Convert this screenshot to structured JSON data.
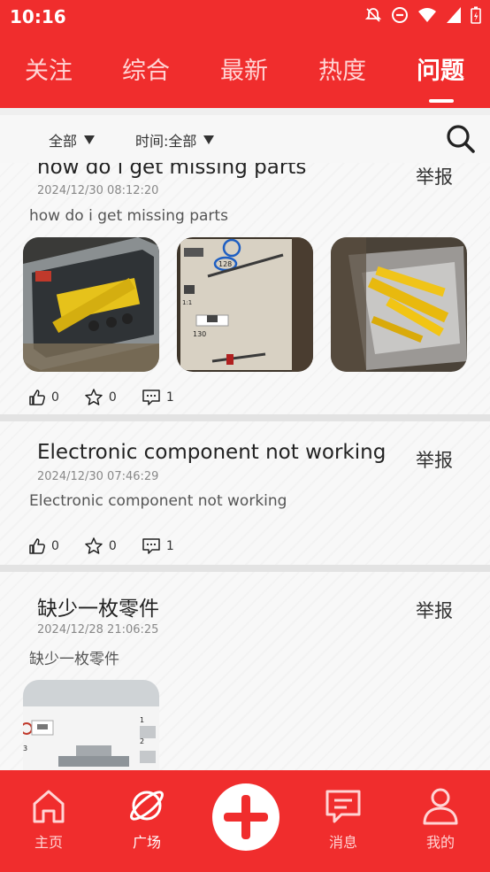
{
  "status_bar": {
    "time": "10:16",
    "icons": [
      "bell-off-icon",
      "do-not-disturb-icon",
      "wifi-icon",
      "signal-icon",
      "battery-icon"
    ]
  },
  "top_tabs": [
    {
      "label": "关注",
      "active": false
    },
    {
      "label": "综合",
      "active": false
    },
    {
      "label": "最新",
      "active": false
    },
    {
      "label": "热度",
      "active": false
    },
    {
      "label": "问题",
      "active": true
    }
  ],
  "filters": {
    "category": "全部",
    "time": "时间:全部"
  },
  "colors": {
    "brand": "#f02d2d",
    "text": "#222222",
    "muted": "#888888"
  },
  "posts": [
    {
      "title": "how do i get missing parts",
      "date": "2024/12/30 08:12:20",
      "description": "how do i get missing parts",
      "report_label": "举报",
      "likes": "0",
      "favorites": "0",
      "comments": "1",
      "image_count": 3
    },
    {
      "title": "Electronic component not working",
      "date": "2024/12/30 07:46:29",
      "description": "Electronic component not working",
      "report_label": "举报",
      "likes": "0",
      "favorites": "0",
      "comments": "1",
      "image_count": 0
    },
    {
      "title": "缺少一枚零件",
      "date": "2024/12/28 21:06:25",
      "description": "缺少一枚零件",
      "report_label": "举报",
      "image_count": 1
    }
  ],
  "bottom_nav": [
    {
      "label": "主页",
      "icon": "home-icon",
      "active": false
    },
    {
      "label": "广场",
      "icon": "planet-icon",
      "active": true
    },
    {
      "label": "",
      "icon": "plus-icon",
      "active": false
    },
    {
      "label": "消息",
      "icon": "message-icon",
      "active": false
    },
    {
      "label": "我的",
      "icon": "profile-icon",
      "active": false
    }
  ]
}
